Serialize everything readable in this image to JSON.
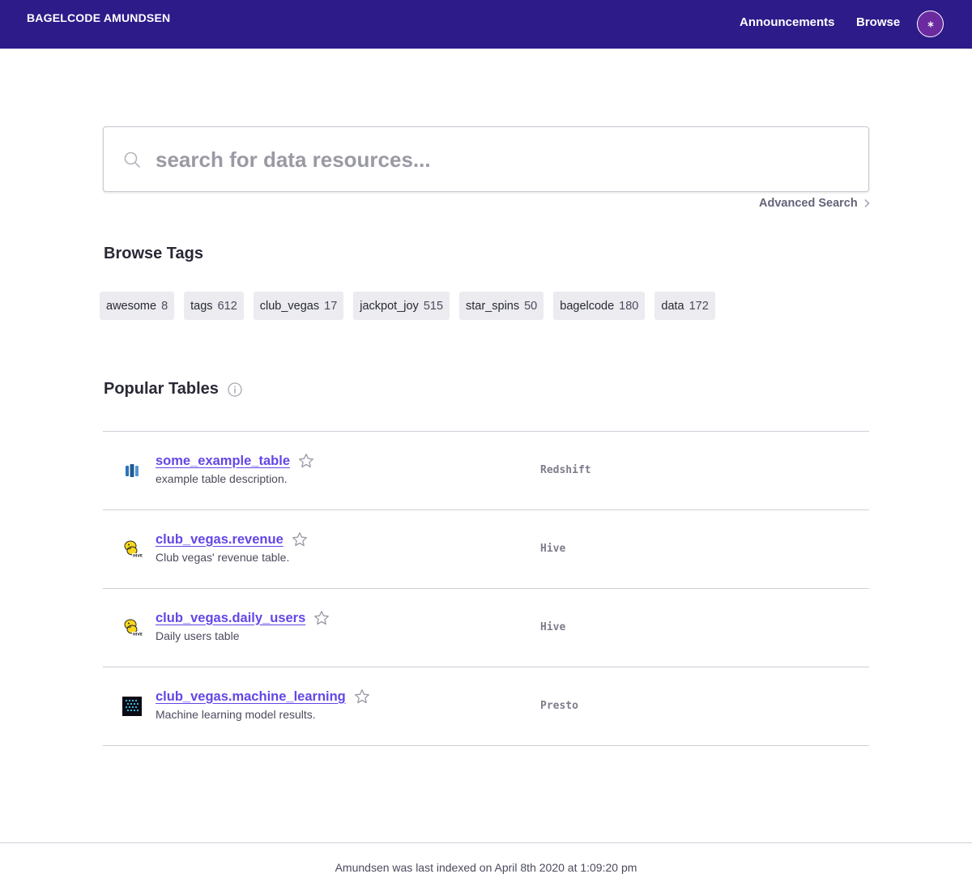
{
  "nav": {
    "brand": "BAGELCODE AMUNDSEN",
    "links": [
      "Announcements",
      "Browse"
    ],
    "avatar_icon": "user-avatar-icon"
  },
  "search": {
    "placeholder": "search for data resources...",
    "advanced_label": "Advanced Search"
  },
  "browse_tags": {
    "title": "Browse Tags",
    "tags": [
      {
        "name": "awesome",
        "count": "8"
      },
      {
        "name": "tags",
        "count": "612"
      },
      {
        "name": "club_vegas",
        "count": "17"
      },
      {
        "name": "jackpot_joy",
        "count": "515"
      },
      {
        "name": "star_spins",
        "count": "50"
      },
      {
        "name": "bagelcode",
        "count": "180"
      },
      {
        "name": "data",
        "count": "172"
      }
    ]
  },
  "popular_tables": {
    "title": "Popular Tables",
    "rows": [
      {
        "name": "some_example_table",
        "description": "example table description.",
        "source": "Redshift",
        "icon": "redshift-icon"
      },
      {
        "name": "club_vegas.revenue",
        "description": "Club vegas' revenue table.",
        "source": "Hive",
        "icon": "hive-icon"
      },
      {
        "name": "club_vegas.daily_users",
        "description": "Daily users table",
        "source": "Hive",
        "icon": "hive-icon"
      },
      {
        "name": "club_vegas.machine_learning",
        "description": "Machine learning model results.",
        "source": "Presto",
        "icon": "presto-icon"
      }
    ]
  },
  "footer": {
    "text": "Amundsen was last indexed on April 8th 2020 at 1:09:20 pm"
  },
  "colors": {
    "nav_bg": "#2d1b8a",
    "link": "#6446e6",
    "chip_bg": "#ebebf0",
    "avatar": "#6b2a9f"
  }
}
